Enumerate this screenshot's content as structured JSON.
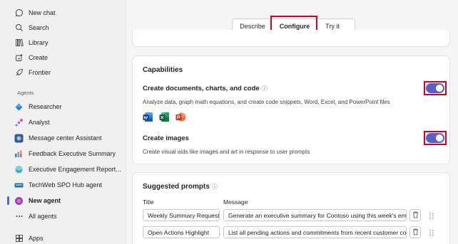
{
  "sidebar": {
    "items": [
      {
        "label": "New chat",
        "icon": "chat-bubble-icon"
      },
      {
        "label": "Search",
        "icon": "search-icon"
      },
      {
        "label": "Library",
        "icon": "library-icon"
      },
      {
        "label": "Create",
        "icon": "create-icon"
      },
      {
        "label": "Frontier",
        "icon": "frontier-icon"
      }
    ],
    "agents_label": "Agents",
    "agents": [
      {
        "label": "Researcher",
        "icon": "researcher-icon",
        "color": "#2a73d9"
      },
      {
        "label": "Analyst",
        "icon": "analyst-icon",
        "color": "#d94fd0"
      },
      {
        "label": "Message center Assistant",
        "icon": "message-center-icon",
        "color": "#2f5b8f"
      },
      {
        "label": "Feedback Executive Summary",
        "icon": "feedback-icon",
        "color": "#3b82c4"
      },
      {
        "label": "Executive Engagement Report...",
        "icon": "engagement-icon",
        "color": "#2aa59a"
      },
      {
        "label": "TechWeb SPO Hub agent",
        "icon": "techweb-icon",
        "color": "#1f6fb0"
      },
      {
        "label": "New agent",
        "icon": "new-agent-icon",
        "color": "#8e44ad"
      },
      {
        "label": "All agents",
        "icon": "more-icon"
      }
    ],
    "apps_label": "Apps"
  },
  "tabs": {
    "describe": "Describe",
    "configure": "Configure",
    "try_it": "Try it"
  },
  "capabilities": {
    "title": "Capabilities",
    "docs": {
      "title": "Create documents, charts, and code",
      "description": "Analyze data, graph math equations, and create code snippets, Word, Excel, and PowerPoint files",
      "enabled": true
    },
    "images": {
      "title": "Create images",
      "description": "Create visual aids like images and art in response to user prompts",
      "enabled": true
    },
    "file_icons": [
      "word-icon",
      "excel-icon",
      "powerpoint-icon"
    ]
  },
  "suggested": {
    "title": "Suggested prompts",
    "col_title": "Title",
    "col_message": "Message",
    "rows": [
      {
        "title": "Weekly Summary Request",
        "message": "Generate an executive summary for Contoso using this week's ema"
      },
      {
        "title": "Open Actions Highlight",
        "message": "List all pending actions and commitments from recent customer co"
      }
    ]
  },
  "colors": {
    "accent": "#5b5fc7",
    "highlight": "#d0021b"
  }
}
